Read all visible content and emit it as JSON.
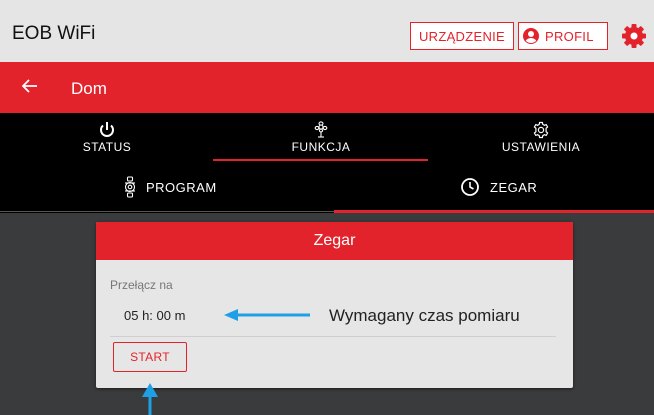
{
  "header": {
    "app_title": "EOB WiFi",
    "device_button": "URZĄDZENIE",
    "profile_button": "PROFIL",
    "accent_color": "#e3232b"
  },
  "nav": {
    "title": "Dom"
  },
  "tabs": [
    {
      "label": "STATUS",
      "icon": "power-icon"
    },
    {
      "label": "FUNKCJA",
      "icon": "fan-icon"
    },
    {
      "label": "USTAWIENIA",
      "icon": "gear-icon"
    }
  ],
  "subtabs": [
    {
      "label": "PROGRAM",
      "icon": "program-icon"
    },
    {
      "label": "ZEGAR",
      "icon": "clock-icon"
    }
  ],
  "card": {
    "title": "Zegar",
    "switch_label": "Przełącz na",
    "time_value": "05 h: 00 m",
    "start_button": "START"
  },
  "annotation": {
    "text": "Wymagany czas pomiaru"
  }
}
